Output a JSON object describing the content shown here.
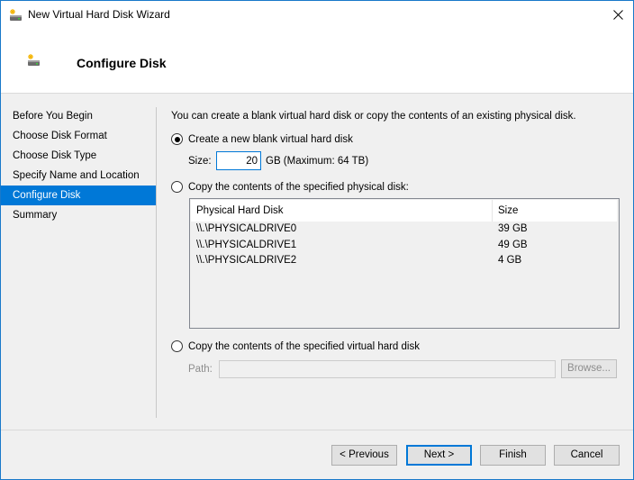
{
  "window": {
    "title": "New Virtual Hard Disk Wizard",
    "accent_color": "#0078d7"
  },
  "header": {
    "title": "Configure Disk",
    "icon": "new-virtual-disk-icon"
  },
  "nav": {
    "items": [
      {
        "label": "Before You Begin",
        "active": false
      },
      {
        "label": "Choose Disk Format",
        "active": false
      },
      {
        "label": "Choose Disk Type",
        "active": false
      },
      {
        "label": "Specify Name and Location",
        "active": false
      },
      {
        "label": "Configure Disk",
        "active": true
      },
      {
        "label": "Summary",
        "active": false
      }
    ]
  },
  "content": {
    "intro": "You can create a blank virtual hard disk or copy the contents of an existing physical disk.",
    "option_new": {
      "label": "Create a new blank virtual hard disk",
      "checked": true,
      "size_label": "Size:",
      "size_value": "20",
      "size_unit": "GB (Maximum: 64 TB)"
    },
    "option_physical": {
      "label": "Copy the contents of the specified physical disk:",
      "checked": false,
      "table": {
        "columns": [
          "Physical Hard Disk",
          "Size"
        ],
        "rows": [
          [
            "\\\\.\\PHYSICALDRIVE0",
            "39 GB"
          ],
          [
            "\\\\.\\PHYSICALDRIVE1",
            "49 GB"
          ],
          [
            "\\\\.\\PHYSICALDRIVE2",
            "4 GB"
          ]
        ]
      }
    },
    "option_virtual": {
      "label": "Copy the contents of the specified virtual hard disk",
      "checked": false,
      "path_label": "Path:",
      "path_value": "",
      "browse_label": "Browse..."
    }
  },
  "footer": {
    "previous_label": "< Previous",
    "next_label": "Next >",
    "finish_label": "Finish",
    "cancel_label": "Cancel"
  }
}
